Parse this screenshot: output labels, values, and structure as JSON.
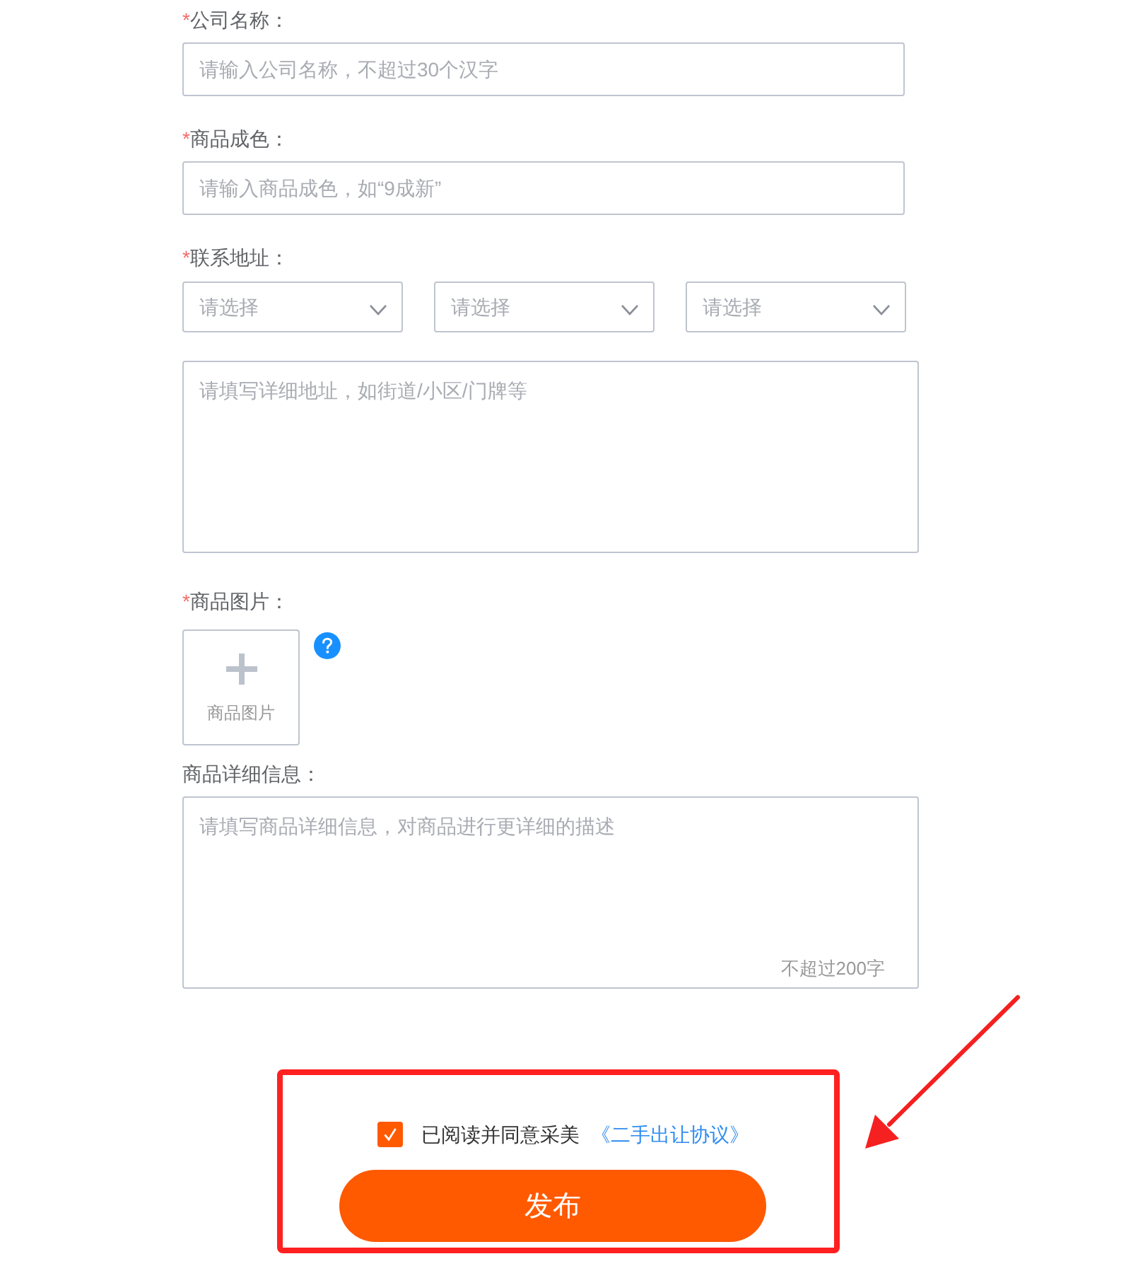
{
  "form": {
    "fields": [
      {
        "kind": "text",
        "required_mark": "*",
        "label": "公司名称：",
        "placeholder": "请输入公司名称，不超过30个汉字"
      },
      {
        "kind": "text",
        "required_mark": "*",
        "label": "商品成色：",
        "placeholder": "请输入商品成色，如“9成新”"
      },
      {
        "kind": "address",
        "required_mark": "*",
        "label": "联系地址：",
        "selects": [
          {
            "placeholder": "请选择"
          },
          {
            "placeholder": "请选择"
          },
          {
            "placeholder": "请选择"
          }
        ],
        "detail": {
          "placeholder": "请填写详细地址，如街道/小区/门牌等"
        }
      },
      {
        "kind": "upload",
        "required_mark": "*",
        "label": "商品图片：",
        "upload_label": "商品图片"
      },
      {
        "kind": "description",
        "label": "商品详细信息：",
        "placeholder": "请填写商品详细信息，对商品进行更详细的描述",
        "counter": "不超过200字"
      }
    ]
  },
  "agreement": {
    "checked": true,
    "text": "已阅读并同意采美",
    "link": "《二手出让协议》"
  },
  "submit_button": "发布",
  "annotation": {
    "highlight_box": true,
    "arrow": true
  }
}
